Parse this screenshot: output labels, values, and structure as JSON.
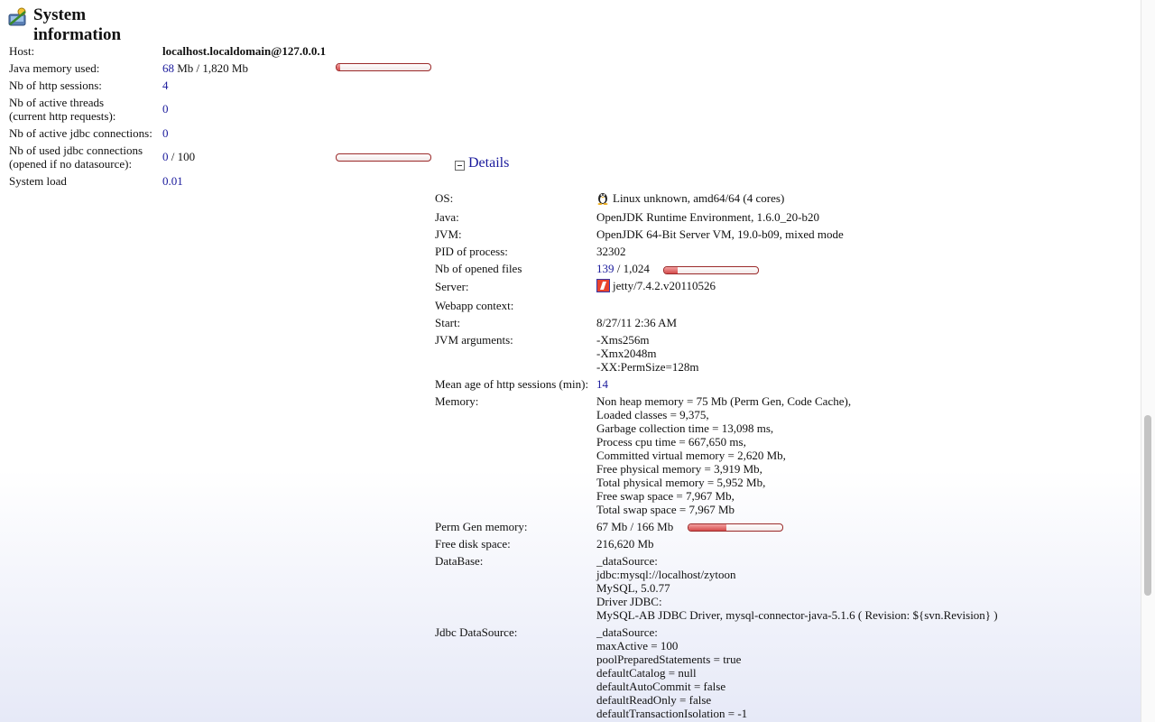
{
  "header": {
    "title": "System information",
    "icon": "system-info-icon"
  },
  "summary": {
    "host_label": "Host:",
    "host_value": "localhost.localdomain@127.0.0.1",
    "memory_label": "Java memory used:",
    "memory_used": "68",
    "memory_rest": " Mb / 1,820 Mb",
    "memory_fraction": 0.04,
    "sessions_label": "Nb of http sessions:",
    "sessions_value": "4",
    "threads_label_1": "Nb of active threads",
    "threads_label_2": "(current http requests):",
    "threads_value": "0",
    "jdbc_active_label": "Nb of active jdbc connections:",
    "jdbc_active_value": "0",
    "jdbc_used_label_1": "Nb of used jdbc connections",
    "jdbc_used_label_2": "(opened if no datasource):",
    "jdbc_used_value": "0",
    "jdbc_used_rest": " / 100",
    "jdbc_used_fraction": 0.0,
    "load_label": "System load",
    "load_value": "0.01"
  },
  "details": {
    "toggle_label": "Details",
    "os_label": "OS:",
    "os_value": "Linux unknown, amd64/64 (4 cores)",
    "os_icon": "linux-icon",
    "java_label": "Java:",
    "java_value": "OpenJDK Runtime Environment, 1.6.0_20-b20",
    "jvm_label": "JVM:",
    "jvm_value": "OpenJDK 64-Bit Server VM, 19.0-b09, mixed mode",
    "pid_label": "PID of process:",
    "pid_value": "32302",
    "files_label": "Nb of opened files",
    "files_used": "139",
    "files_rest": " / 1,024",
    "files_fraction": 0.14,
    "server_label": "Server:",
    "server_value": "jetty/7.4.2.v20110526",
    "server_icon": "jetty-icon",
    "webapp_label": "Webapp context:",
    "webapp_value": "",
    "start_label": "Start:",
    "start_value": "8/27/11 2:36 AM",
    "jvmargs_label": "JVM arguments:",
    "jvmargs_lines": [
      "-Xms256m",
      "-Xmx2048m",
      "-XX:PermSize=128m"
    ],
    "meanage_label": "Mean age of http sessions (min):",
    "meanage_value": "14",
    "memory_label": "Memory:",
    "memory_lines": [
      "Non heap memory = 75 Mb (Perm Gen, Code Cache),",
      "Loaded classes = 9,375,",
      "Garbage collection time = 13,098 ms,",
      "Process cpu time = 667,650 ms,",
      "Committed virtual memory = 2,620 Mb,",
      "Free physical memory = 3,919 Mb,",
      "Total physical memory = 5,952 Mb,",
      "Free swap space = 7,967 Mb,",
      "Total swap space = 7,967 Mb"
    ],
    "permgen_label": "Perm Gen memory:",
    "permgen_value": "67 Mb / 166 Mb",
    "permgen_fraction": 0.4,
    "disk_label": "Free disk space:",
    "disk_value": "216,620 Mb",
    "db_label": "DataBase:",
    "db_lines": [
      "_dataSource:",
      "jdbc:mysql://localhost/zytoon",
      "MySQL, 5.0.77",
      "Driver JDBC:",
      "MySQL-AB JDBC Driver, mysql-connector-java-5.1.6 ( Revision: ${svn.Revision} )"
    ],
    "ds_label": "Jdbc DataSource:",
    "ds_lines": [
      "_dataSource:",
      "maxActive = 100",
      "poolPreparedStatements = true",
      "defaultCatalog = null",
      "defaultAutoCommit = false",
      "defaultReadOnly = false",
      "defaultTransactionIsolation = -1"
    ]
  },
  "colors": {
    "link": "#1a1a9c",
    "bar_fill": "#d44b4b",
    "bar_border": "#9b2a2a"
  }
}
